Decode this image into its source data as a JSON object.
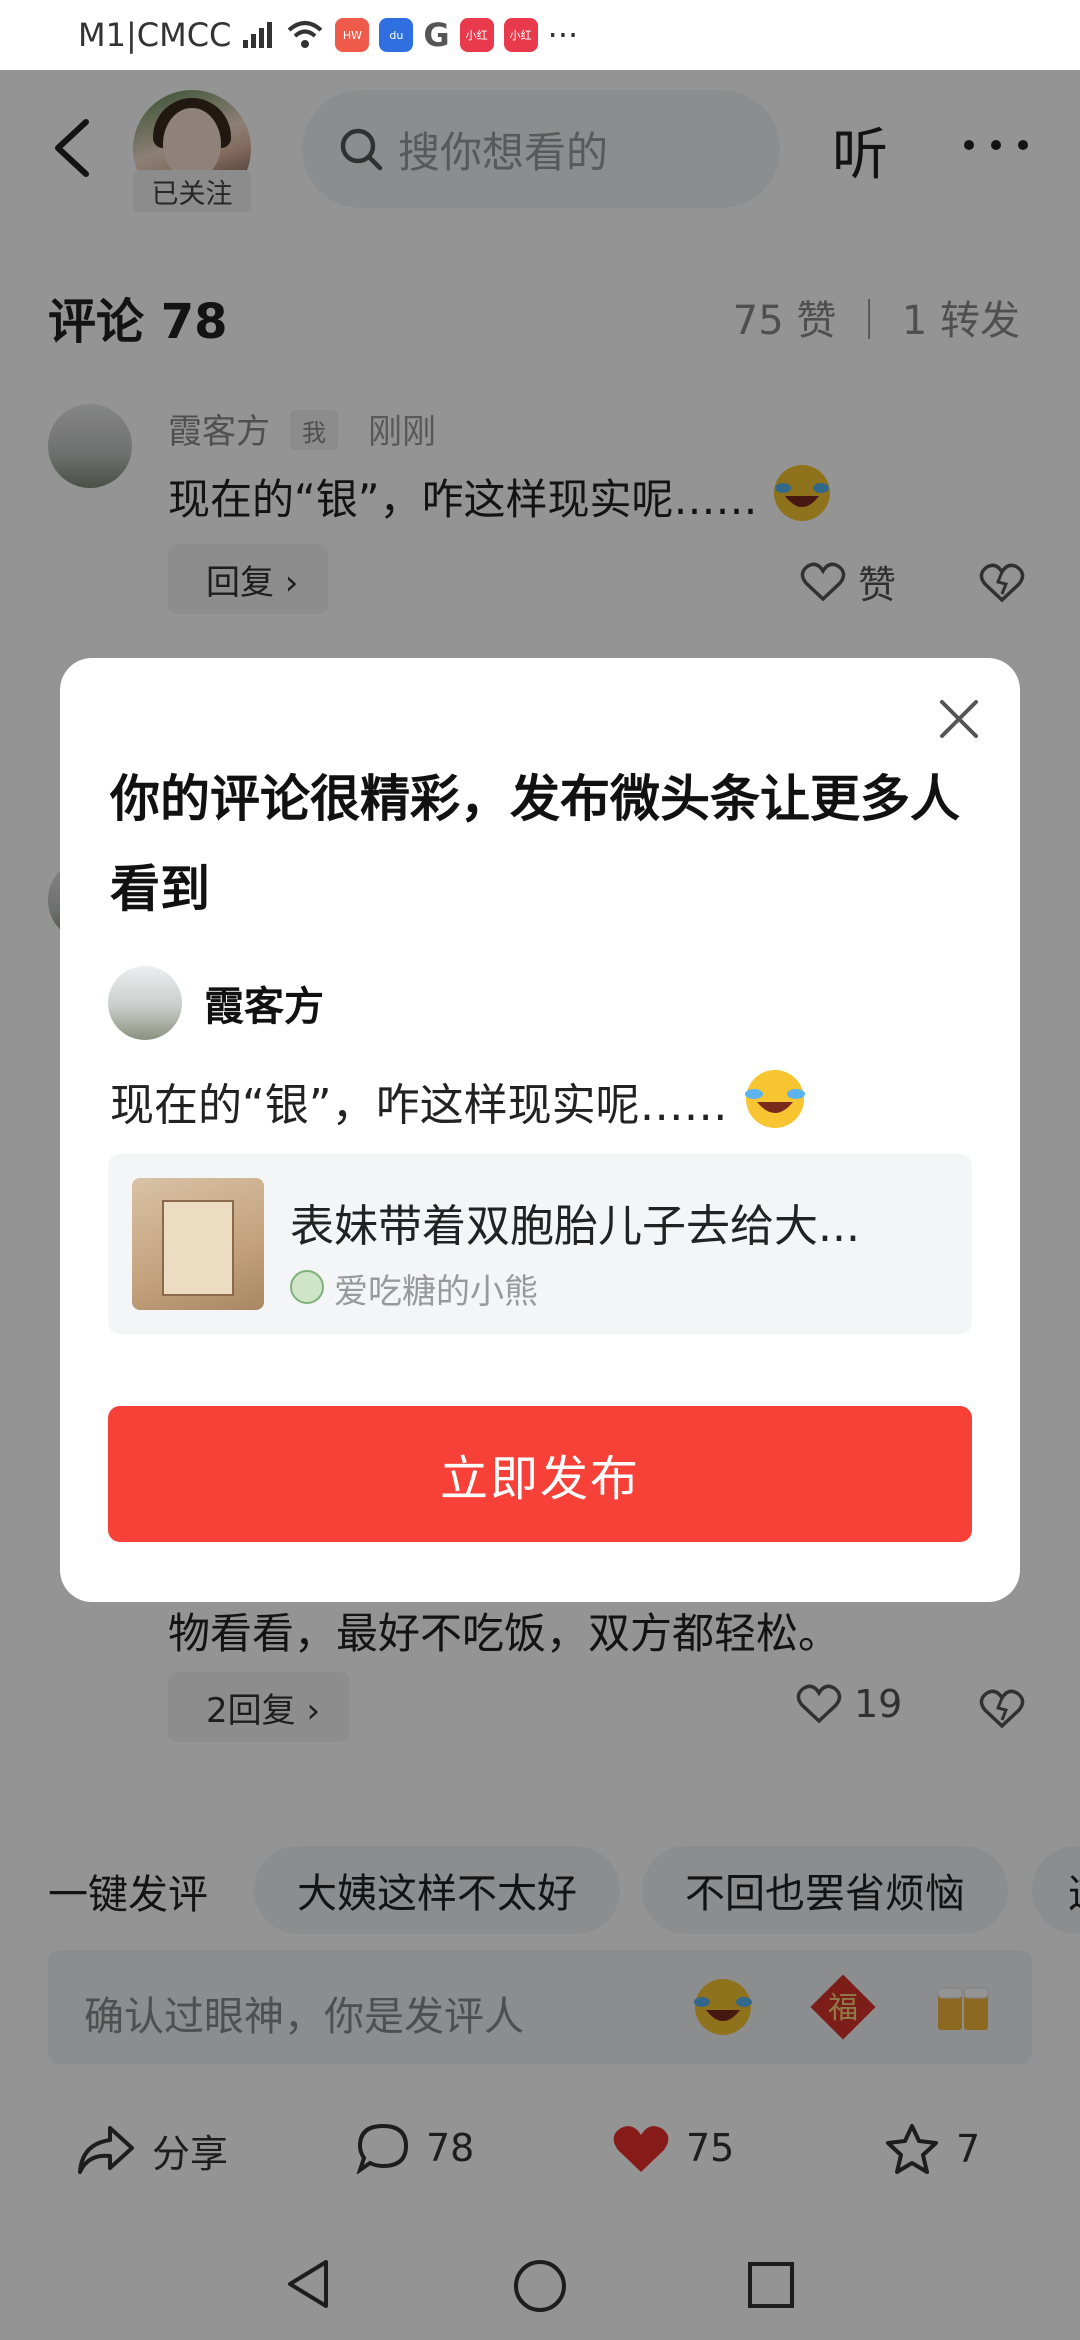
{
  "status_bar": {
    "carrier": "M1|CMCC",
    "more": "···"
  },
  "top_nav": {
    "followed_label": "已关注",
    "search_placeholder": "搜你想看的",
    "listen_label": "听"
  },
  "comments_header": {
    "title": "评论 78",
    "stats": "75 赞 ｜ 1 转发"
  },
  "first_comment": {
    "author": "霞客方",
    "me_tag": "我",
    "time": "刚刚",
    "text": "现在的“银”，咋这样现实呢……",
    "reply_label": "回复 ›",
    "like_label": "赞"
  },
  "background_comment": {
    "text_tail": "物看看，最好不吃饭，双方都轻松。",
    "reply_label": "2回复 ›",
    "like_count": "19"
  },
  "quick_replies": {
    "label": "一键发评",
    "chips": [
      "大姨这样不太好",
      "不回也罢省烦恼",
      "这"
    ]
  },
  "input_bar": {
    "placeholder": "确认过眼神，你是发评人"
  },
  "bottom_bar": {
    "share_label": "分享",
    "comment_count": "78",
    "like_count": "75",
    "favorite_count": "7"
  },
  "modal": {
    "title": "你的评论很精彩，发布微头条让更多人看到",
    "author": "霞客方",
    "text": "现在的“银”，咋这样现实呢……",
    "quote": {
      "title": "表妹带着双胞胎儿子去给大...",
      "author": "爱吃糖的小熊"
    },
    "publish_label": "立即发布"
  },
  "colors": {
    "accent_red": "#f74037",
    "heart_red": "#e8302e"
  }
}
